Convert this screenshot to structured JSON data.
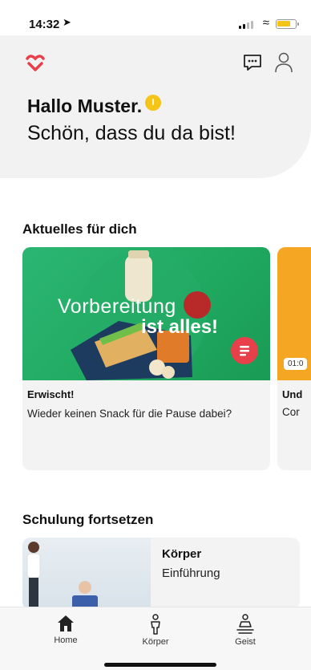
{
  "status": {
    "time": "14:32"
  },
  "header": {
    "greeting": "Hallo Muster.",
    "welcome": "Schön, dass du da bist!"
  },
  "news": {
    "title": "Aktuelles für dich",
    "card1": {
      "image_line1": "Vorbereitung",
      "image_line2": "ist alles!",
      "eyebrow": "Erwischt!",
      "description": "Wieder keinen Snack für die Pause dabei?"
    },
    "card2": {
      "time": "01:0",
      "eyebrow": "Und",
      "description": "Cor"
    }
  },
  "courses": {
    "title": "Schulung fortsetzen",
    "item": {
      "title": "Körper",
      "subtitle": "Einführung"
    }
  },
  "tabs": [
    {
      "label": "Home"
    },
    {
      "label": "Körper"
    },
    {
      "label": "Geist"
    }
  ],
  "colors": {
    "accent": "#e8404a",
    "badge": "#f5c418",
    "card_green": "#2bb673",
    "card_orange": "#f5a623"
  }
}
